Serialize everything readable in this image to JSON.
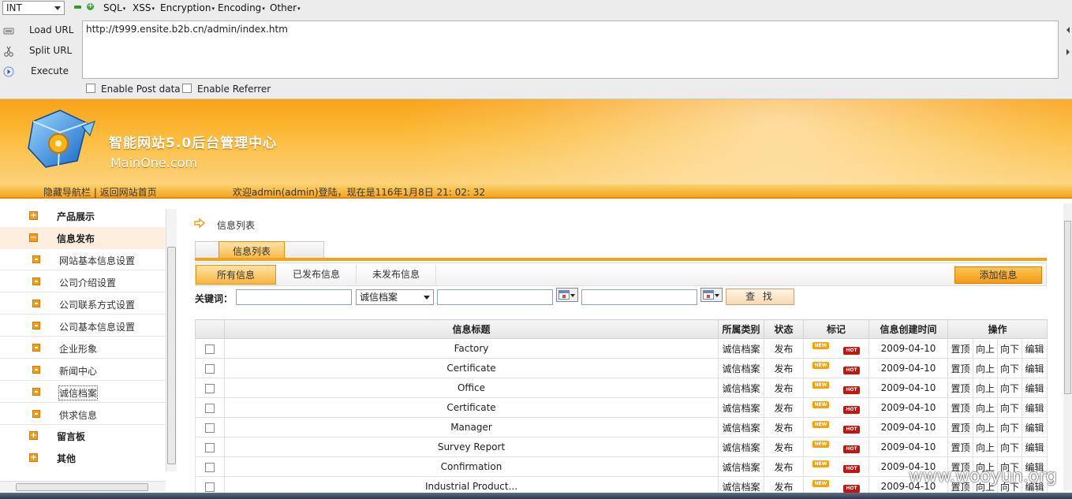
{
  "hackbar": {
    "select_value": "INT",
    "menus": [
      {
        "id": "sql",
        "label": "SQL"
      },
      {
        "id": "xss",
        "label": "XSS"
      },
      {
        "id": "encryption",
        "label": "Encryption"
      },
      {
        "id": "encoding",
        "label": "Encoding"
      },
      {
        "id": "other",
        "label": "Other"
      }
    ],
    "load_url": "Load URL",
    "split_url": "Split URL",
    "execute": "Execute",
    "url_value": "http://t999.ensite.b2b.cn/admin/index.htm",
    "enable_post": "Enable Post data",
    "enable_referrer": "Enable Referrer"
  },
  "header": {
    "title": "智能网站5.0后台管理中心",
    "subtitle": "MainOne.com",
    "nav_links": "隐藏导航栏 | 返回网站首页",
    "welcome": "欢迎admin(admin)登陆，现在是116年1月8日 21: 02: 32"
  },
  "sidebar": {
    "top_items": [
      {
        "label": "产品展示",
        "icon": "+"
      },
      {
        "label": "信息发布",
        "icon": "−"
      },
      {
        "label": "留言板",
        "icon": "+"
      },
      {
        "label": "其他",
        "icon": "+"
      }
    ],
    "sub_items": [
      {
        "label": "网站基本信息设置"
      },
      {
        "label": "公司介绍设置"
      },
      {
        "label": "公司联系方式设置"
      },
      {
        "label": "公司基本信息设置"
      },
      {
        "label": "企业形象"
      },
      {
        "label": "新闻中心"
      },
      {
        "label": "诚信档案"
      },
      {
        "label": "供求信息"
      }
    ]
  },
  "main": {
    "breadcrumb": "信息列表",
    "tab": "信息列表",
    "filter_tabs": {
      "all": "所有信息",
      "published": "已发布信息",
      "unpublished": "未发布信息"
    },
    "add_button": "添加信息",
    "keyword_label": "关键词：",
    "category_selected": "诚信档案",
    "search_button": "查 找",
    "columns": {
      "title": "信息标题",
      "category": "所属类别",
      "status": "状态",
      "mark": "标记",
      "created": "信息创建时间",
      "ops": "操作"
    },
    "tags": {
      "new": "NEW",
      "hot": "HOT"
    },
    "ops": {
      "top": "置顶",
      "up": "向上",
      "down": "向下",
      "edit": "编辑"
    },
    "rows": [
      {
        "title": "Factory",
        "category": "诚信档案",
        "status": "发布",
        "date": "2009-04-10"
      },
      {
        "title": "Certificate",
        "category": "诚信档案",
        "status": "发布",
        "date": "2009-04-10"
      },
      {
        "title": "Office",
        "category": "诚信档案",
        "status": "发布",
        "date": "2009-04-10"
      },
      {
        "title": "Certificate",
        "category": "诚信档案",
        "status": "发布",
        "date": "2009-04-10"
      },
      {
        "title": "Manager",
        "category": "诚信档案",
        "status": "发布",
        "date": "2009-04-10"
      },
      {
        "title": "Survey Report",
        "category": "诚信档案",
        "status": "发布",
        "date": "2009-04-10"
      },
      {
        "title": "Confirmation",
        "category": "诚信档案",
        "status": "发布",
        "date": "2009-04-10"
      },
      {
        "title": "Industrial Product...",
        "category": "诚信档案",
        "status": "发布",
        "date": "2009-04-10"
      }
    ]
  },
  "watermark": "www.wooyun.org",
  "colors": {
    "accent": "#f7a21b",
    "op_link": "#f39010",
    "hot": "#c8120c"
  }
}
